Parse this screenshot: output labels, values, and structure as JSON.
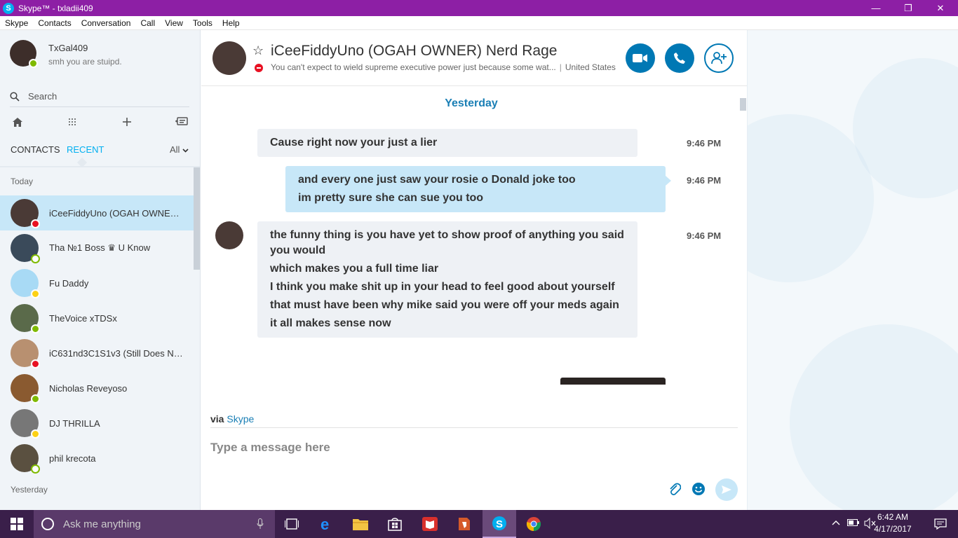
{
  "window": {
    "title": "Skype™ - txladii409",
    "minimize": "—",
    "maximize": "❐",
    "close": "✕"
  },
  "menu": [
    "Skype",
    "Contacts",
    "Conversation",
    "Call",
    "View",
    "Tools",
    "Help"
  ],
  "profile": {
    "name": "TxGal409",
    "mood": "smh you are stuipd."
  },
  "search": {
    "placeholder": "Search"
  },
  "tabs": {
    "contacts": "CONTACTS",
    "recent": "RECENT",
    "filter": "All"
  },
  "sections": {
    "today": "Today",
    "yesterday": "Yesterday"
  },
  "contacts": [
    {
      "name": "iCeeFiddyUno (OGAH OWNER)...",
      "status": "dnd"
    },
    {
      "name": "Tha №1 Boss ♛ U Know",
      "status": "offline"
    },
    {
      "name": "Fu Daddy",
      "status": "away"
    },
    {
      "name": "TheVoice xTDSx",
      "status": "online"
    },
    {
      "name": "iC631nd3C1S1v3 (Still Does No...",
      "status": "dnd"
    },
    {
      "name": "Nicholas Reveyoso",
      "status": "online"
    },
    {
      "name": "DJ THRILLA",
      "status": "away"
    },
    {
      "name": "phil krecota",
      "status": "offline"
    }
  ],
  "chat": {
    "name": "iCeeFiddyUno (OGAH OWNER) Nerd Rage",
    "mood": "You can't expect to wield supreme executive power just because some wat...",
    "separator": "|",
    "location": "United States",
    "day": "Yesterday",
    "messages": [
      {
        "direction": "in",
        "time": "9:46 PM",
        "lines": [
          "Cause right now your just a lier"
        ]
      },
      {
        "direction": "out",
        "time": "9:46 PM",
        "lines": [
          "and every one just saw your rosie  o Donald joke too",
          "im pretty sure she can sue you too"
        ]
      },
      {
        "direction": "in",
        "time": "9:46 PM",
        "lines": [
          "the funny thing is you have yet to show proof of anything you said you would",
          "which makes you a full time liar",
          "I think you make shit up in your head to feel good about yourself",
          "that must have been why mike said you were off your meds again",
          "it all makes sense now"
        ]
      }
    ],
    "via_label": "via",
    "via_link": "Skype",
    "composer_placeholder": "Type a message here"
  },
  "taskbar": {
    "search_placeholder": "Ask me anything",
    "time": "6:42 AM",
    "date": "4/17/2017"
  },
  "colors": {
    "titlebar": "#8d1fa5",
    "accent": "#00aff0",
    "button_blue": "#0078b4",
    "outgoing_bubble": "#c7e7f8",
    "incoming_bubble": "#eef1f5",
    "taskbar": "#3a1f4a"
  }
}
